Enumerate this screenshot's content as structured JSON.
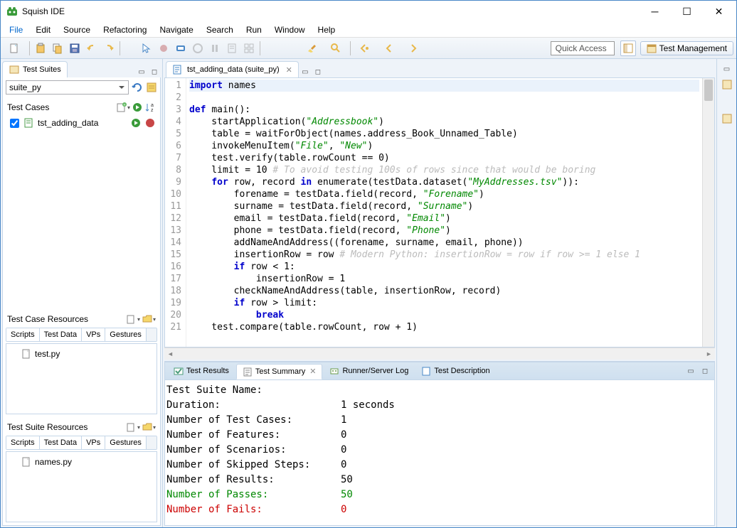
{
  "window": {
    "title": "Squish IDE"
  },
  "menu": [
    "File",
    "Edit",
    "Source",
    "Refactoring",
    "Navigate",
    "Search",
    "Run",
    "Window",
    "Help"
  ],
  "toolbar": {
    "quick_access": "Quick Access",
    "perspective": "Test Management"
  },
  "left": {
    "suites_tab": "Test Suites",
    "suite_selected": "suite_py",
    "test_cases_label": "Test Cases",
    "test_case_items": [
      {
        "name": "tst_adding_data",
        "checked": true
      }
    ],
    "tc_resources_label": "Test Case Resources",
    "ts_resources_label": "Test Suite Resources",
    "sub_tabs": [
      "Scripts",
      "Test Data",
      "VPs",
      "Gestures"
    ],
    "tc_files": [
      "test.py"
    ],
    "ts_files": [
      "names.py"
    ]
  },
  "editor": {
    "tab_label": "tst_adding_data (suite_py)",
    "lines": [
      {
        "n": 1,
        "html": "<span class='kw'>import</span> names",
        "hl": true
      },
      {
        "n": 2,
        "html": ""
      },
      {
        "n": 3,
        "html": "<span class='kw'>def</span> <span class='fn'>main</span>():"
      },
      {
        "n": 4,
        "html": "    startApplication(<span class='str'>\"Addressbook\"</span>)"
      },
      {
        "n": 5,
        "html": "    table = waitForObject(names.address_Book_Unnamed_Table)"
      },
      {
        "n": 6,
        "html": "    invokeMenuItem(<span class='str'>\"File\"</span>, <span class='str'>\"New\"</span>)"
      },
      {
        "n": 7,
        "html": "    test.verify(table.rowCount == 0)"
      },
      {
        "n": 8,
        "html": "    limit = 10 <span class='cm'># To avoid testing 100s of rows since that would be boring</span>"
      },
      {
        "n": 9,
        "html": "    <span class='kw'>for</span> row, record <span class='kw'>in</span> enumerate(testData.dataset(<span class='str'>\"MyAddresses.tsv\"</span>)):"
      },
      {
        "n": 10,
        "html": "        forename = testData.field(record, <span class='str'>\"Forename\"</span>)"
      },
      {
        "n": 11,
        "html": "        surname = testData.field(record, <span class='str'>\"Surname\"</span>)"
      },
      {
        "n": 12,
        "html": "        email = testData.field(record, <span class='str'>\"Email\"</span>)"
      },
      {
        "n": 13,
        "html": "        phone = testData.field(record, <span class='str'>\"Phone\"</span>)"
      },
      {
        "n": 14,
        "html": "        addNameAndAddress((forename, surname, email, phone))"
      },
      {
        "n": 15,
        "html": "        insertionRow = row <span class='cm'># Modern Python: insertionRow = row if row >= 1 else 1</span>"
      },
      {
        "n": 16,
        "html": "        <span class='kw'>if</span> row &lt; 1:"
      },
      {
        "n": 17,
        "html": "            insertionRow = 1"
      },
      {
        "n": 18,
        "html": "        checkNameAndAddress(table, insertionRow, record)"
      },
      {
        "n": 19,
        "html": "        <span class='kw'>if</span> row &gt; limit:"
      },
      {
        "n": 20,
        "html": "            <span class='kw'>break</span>"
      },
      {
        "n": 21,
        "html": "    test.compare(table.rowCount, row + 1)"
      }
    ]
  },
  "bottom": {
    "tabs": [
      "Test Results",
      "Test Summary",
      "Runner/Server Log",
      "Test Description"
    ],
    "active": 1,
    "summary": [
      {
        "k": "Test Suite Name:",
        "v": ""
      },
      {
        "k": "Duration:",
        "v": "1 seconds"
      },
      {
        "k": "Number of Test Cases:",
        "v": "1"
      },
      {
        "k": "Number of Features:",
        "v": "0"
      },
      {
        "k": "Number of Scenarios:",
        "v": "0"
      },
      {
        "k": "Number of Skipped Steps:",
        "v": "0"
      },
      {
        "k": "Number of Results:",
        "v": "50"
      },
      {
        "k": "Number of Passes:",
        "v": "50",
        "cls": "pass"
      },
      {
        "k": "Number of Fails:",
        "v": "0",
        "cls": "fail"
      }
    ]
  }
}
